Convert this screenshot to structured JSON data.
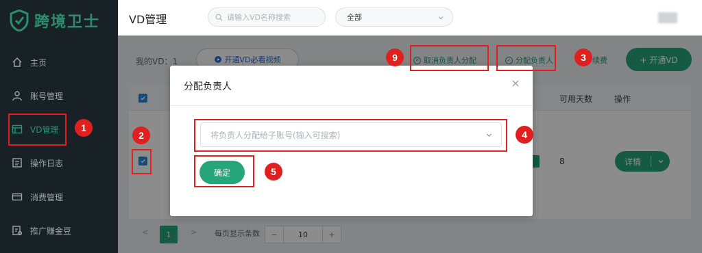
{
  "app": {
    "logo_text": "跨境卫士"
  },
  "sidebar": {
    "items": [
      {
        "label": "主页",
        "icon": "home-icon"
      },
      {
        "label": "账号管理",
        "icon": "user-icon"
      },
      {
        "label": "VD管理",
        "icon": "window-icon",
        "active": true
      },
      {
        "label": "操作日志",
        "icon": "log-icon"
      },
      {
        "label": "消费管理",
        "icon": "card-icon"
      },
      {
        "label": "推广赚金豆",
        "icon": "promo-icon"
      }
    ]
  },
  "header": {
    "title": "VD管理",
    "search_placeholder": "请输入VD名称搜索",
    "filter_value": "全部"
  },
  "toolbar": {
    "my_vd": "我的VD：1",
    "video_button": "开通VD必看视频",
    "cancel_assign": "取消负责人分配",
    "assign": "分配负责人",
    "partial_link": "续费",
    "open_vd": "+ 开通VD"
  },
  "table": {
    "headers": {
      "days": "可用天数",
      "ops": "操作"
    },
    "row": {
      "days": "8",
      "detail": "详情"
    }
  },
  "pagination": {
    "prev": "<",
    "page": "1",
    "next": ">",
    "page_size_label": "每页显示条数",
    "page_size_minus": "−",
    "page_size": "10",
    "page_size_plus": "+"
  },
  "modal": {
    "title": "分配负责人",
    "select_placeholder": "将负责人分配给子账号(输入可搜索)",
    "confirm": "确定"
  },
  "annotations": [
    "1",
    "2",
    "3",
    "4",
    "5",
    "9"
  ],
  "colors": {
    "accent": "#27a57b",
    "sidebar": "#1f2a30",
    "annotation": "#e01f1f",
    "link": "#2a6fd6"
  }
}
